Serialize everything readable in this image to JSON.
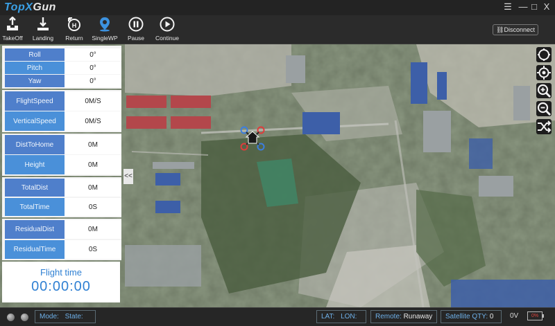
{
  "app": {
    "logo_left": "TopX",
    "logo_right": "Gun"
  },
  "window": {
    "menu_glyph": "☰",
    "minimize_glyph": "—",
    "maximize_glyph": "□",
    "close_glyph": "X"
  },
  "toolbar": {
    "items": [
      {
        "label": "TakeOff",
        "icon": "takeoff-icon"
      },
      {
        "label": "Landing",
        "icon": "landing-icon"
      },
      {
        "label": "Return",
        "icon": "return-home-icon"
      },
      {
        "label": "SingleWP",
        "icon": "waypoint-pin-icon"
      },
      {
        "label": "Pause",
        "icon": "pause-icon"
      },
      {
        "label": "Continue",
        "icon": "play-icon"
      }
    ],
    "disconnect_label": "Disconnect"
  },
  "telemetry": {
    "attitude": [
      {
        "label": "Roll",
        "value": "0°"
      },
      {
        "label": "Pitch",
        "value": "0°"
      },
      {
        "label": "Yaw",
        "value": "0°"
      }
    ],
    "speed": [
      {
        "label": "FlightSpeed",
        "value": "0M/S"
      },
      {
        "label": "VerticalSpeed",
        "value": "0M/S"
      }
    ],
    "position": [
      {
        "label": "DistToHome",
        "value": "0M"
      },
      {
        "label": "Height",
        "value": "0M"
      }
    ],
    "totals": [
      {
        "label": "TotalDist",
        "value": "0M"
      },
      {
        "label": "TotalTime",
        "value": "0S"
      }
    ],
    "residual": [
      {
        "label": "ResidualDist",
        "value": "0M"
      },
      {
        "label": "ResidualTime",
        "value": "0S"
      }
    ],
    "flight_time_label": "Flight time",
    "flight_time_value": "00:00:00",
    "collapse_glyph": "<<"
  },
  "status": {
    "mode_label": "Mode:",
    "state_label": "State:",
    "lat_label": "LAT:",
    "lon_label": "LON:",
    "remote_label": "Remote:",
    "remote_value": "Runaway",
    "satellite_label": "Satellite QTY:",
    "satellite_value": "0",
    "voltage": "0V",
    "battery": "0%"
  },
  "colors": {
    "accent": "#4a90d9",
    "background": "#2b2b2b",
    "battery_low": "#e0453e"
  }
}
